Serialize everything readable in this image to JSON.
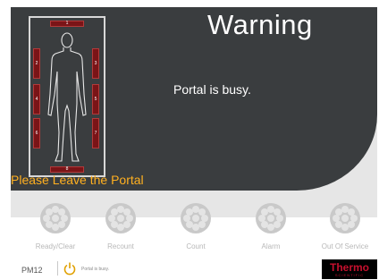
{
  "header": {
    "title": "Warning",
    "message": "Portal is busy.",
    "instruction": "Please Leave the Portal"
  },
  "zones": {
    "z1": "1",
    "z2": "2",
    "z3": "3",
    "z4": "4",
    "z5": "5",
    "z6": "6",
    "z7": "7",
    "z8": "8"
  },
  "buttons": [
    {
      "label": "Ready/Clear"
    },
    {
      "label": "Recount"
    },
    {
      "label": "Count"
    },
    {
      "label": "Alarm"
    },
    {
      "label": "Out Of Service"
    }
  ],
  "status_bar": {
    "device": "PM12",
    "status_text": "Portal is busy."
  },
  "logo": {
    "main": "Thermo",
    "sub": "SCIENTIFIC"
  },
  "colors": {
    "panel": "#3a3d3f",
    "instruction": "#ffb020",
    "zone": "#7a1417",
    "brand_red": "#c8102e"
  },
  "icons": {
    "button_icon": "detector-ring-icon",
    "power": "power-icon"
  }
}
